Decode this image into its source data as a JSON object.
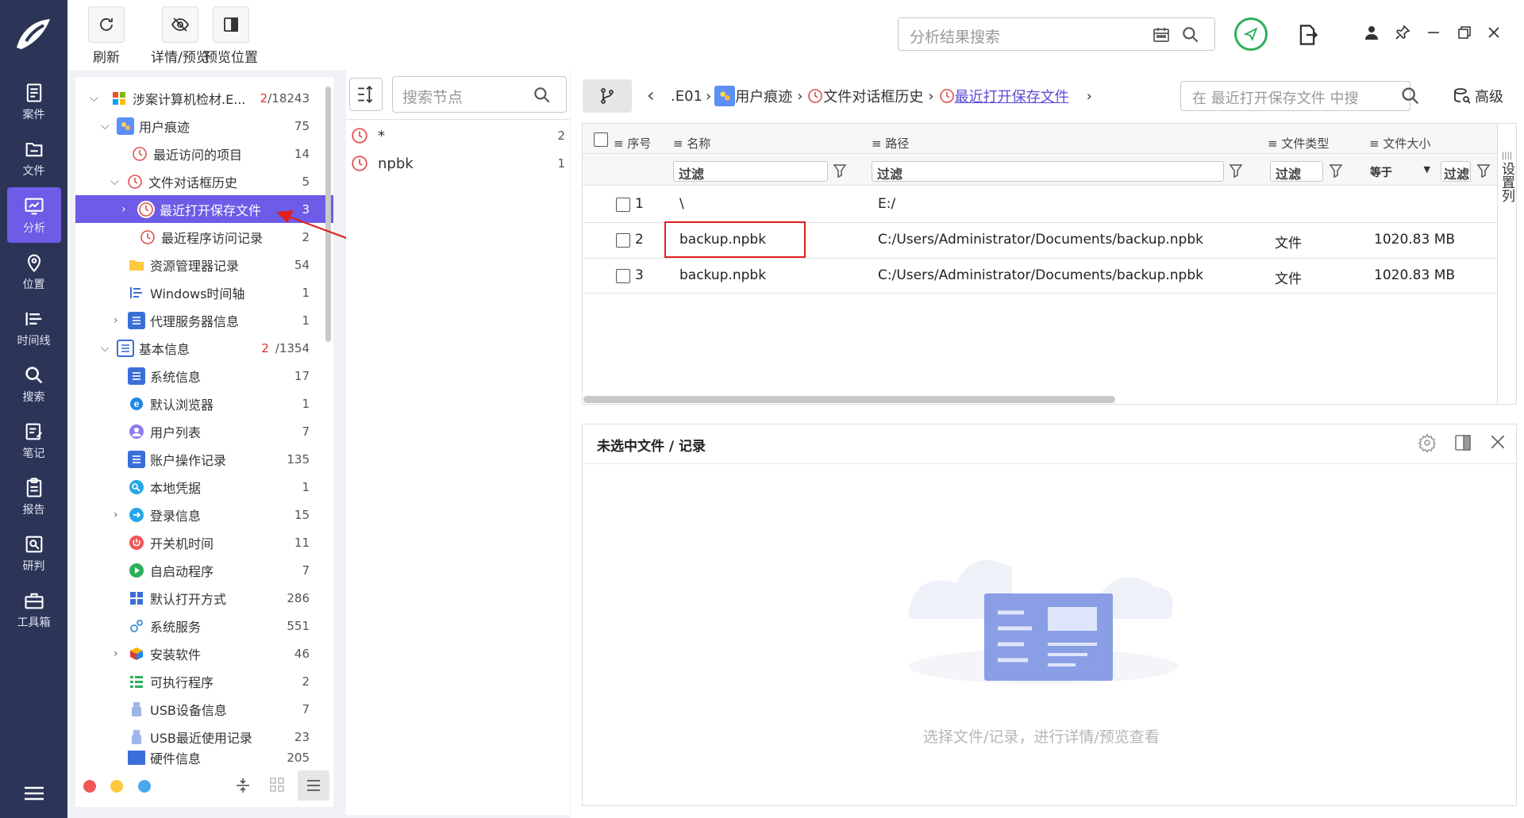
{
  "sidebar": {
    "items": [
      {
        "label": "案件",
        "icon": "case-icon"
      },
      {
        "label": "文件",
        "icon": "folder-icon"
      },
      {
        "label": "分析",
        "icon": "analysis-icon"
      },
      {
        "label": "位置",
        "icon": "location-icon"
      },
      {
        "label": "时间线",
        "icon": "timeline-icon"
      },
      {
        "label": "搜索",
        "icon": "search-icon"
      },
      {
        "label": "笔记",
        "icon": "note-icon"
      },
      {
        "label": "报告",
        "icon": "report-icon"
      },
      {
        "label": "研判",
        "icon": "judge-icon"
      },
      {
        "label": "工具箱",
        "icon": "toolbox-icon"
      }
    ]
  },
  "toolbar": {
    "refresh": "刷新",
    "detail_preview": "详情/预览",
    "preview_position": "预览位置",
    "search_placeholder": "分析结果搜索"
  },
  "tree": {
    "root": {
      "label": "涉案计算机检材.E...",
      "count_red": "2",
      "count": "/18243"
    },
    "items": [
      {
        "label": "用户痕迹",
        "count": "75"
      },
      {
        "label": "最近访问的项目",
        "count": "14"
      },
      {
        "label": "文件对话框历史",
        "count": "5"
      },
      {
        "label": "最近打开保存文件",
        "count": "3"
      },
      {
        "label": "最近程序访问记录",
        "count": "2"
      },
      {
        "label": "资源管理器记录",
        "count": "54"
      },
      {
        "label": "Windows时间轴",
        "count": "1"
      },
      {
        "label": "代理服务器信息",
        "count": "1"
      },
      {
        "label": "基本信息",
        "count_red": "2",
        "count": "/1354"
      },
      {
        "label": "系统信息",
        "count": "17"
      },
      {
        "label": "默认浏览器",
        "count": "1"
      },
      {
        "label": "用户列表",
        "count": "7"
      },
      {
        "label": "账户操作记录",
        "count": "135"
      },
      {
        "label": "本地凭据",
        "count": "1"
      },
      {
        "label": "登录信息",
        "count": "15"
      },
      {
        "label": "开关机时间",
        "count": "11"
      },
      {
        "label": "自启动程序",
        "count": "7"
      },
      {
        "label": "默认打开方式",
        "count": "286"
      },
      {
        "label": "系统服务",
        "count": "551"
      },
      {
        "label": "安装软件",
        "count": "46"
      },
      {
        "label": "可执行程序",
        "count": "2"
      },
      {
        "label": "USB设备信息",
        "count": "7"
      },
      {
        "label": "USB最近使用记录",
        "count": "23"
      },
      {
        "label": "硬件信息",
        "count": "205"
      }
    ]
  },
  "nodes": {
    "search_placeholder": "搜索节点",
    "items": [
      {
        "label": "*",
        "count": "2"
      },
      {
        "label": "npbk",
        "count": "1"
      }
    ]
  },
  "breadcrumb": {
    "items": [
      ".E01",
      "用户痕迹",
      "文件对话框历史",
      "最近打开保存文件"
    ],
    "search_placeholder": "在 最近打开保存文件 中搜",
    "advanced": "高级"
  },
  "grid": {
    "headers": {
      "seq": "序号",
      "name": "名称",
      "path": "路径",
      "type": "文件类型",
      "size": "文件大小"
    },
    "filter": "过滤",
    "equals": "等于",
    "settings_col": "设置列",
    "rows": [
      {
        "seq": "1",
        "name": "\\",
        "path": "E:/",
        "type": "",
        "size": ""
      },
      {
        "seq": "2",
        "name": "backup.npbk",
        "path": "C:/Users/Administrator/Documents/backup.npbk",
        "type": "文件",
        "size": "1020.83 MB"
      },
      {
        "seq": "3",
        "name": "backup.npbk",
        "path": "C:/Users/Administrator/Documents/backup.npbk",
        "type": "文件",
        "size": "1020.83 MB"
      }
    ]
  },
  "preview": {
    "title": "未选中文件 / 记录",
    "empty_hint": "选择文件/记录，进行详情/预览查看"
  },
  "colors": {
    "sidebar": "#2c3558",
    "accent": "#6c5ce7",
    "highlight": "#e02020"
  }
}
